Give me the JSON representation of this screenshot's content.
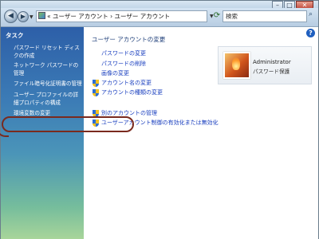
{
  "window": {
    "caption_buttons": {
      "minimize": "–",
      "maximize": "□",
      "close": "✕"
    }
  },
  "address": {
    "path": "« ユーザー アカウント › ユーザー アカウント",
    "search_placeholder": "検索"
  },
  "sidebar": {
    "heading": "タスク",
    "items": [
      {
        "label": "パスワード リセット ディスクの作成"
      },
      {
        "label": "ネットワーク パスワードの管理"
      },
      {
        "label": "ファイル暗号化証明書の管理"
      },
      {
        "label": "ユーザー プロファイルの詳細プロパティの構成"
      },
      {
        "label": "環境変数の変更"
      }
    ]
  },
  "main": {
    "title": "ユーザー アカウントの変更",
    "links": [
      {
        "label": "パスワードの変更"
      },
      {
        "label": "パスワードの削除"
      },
      {
        "label": "画像の変更"
      },
      {
        "label": "アカウント名の変更"
      },
      {
        "label": "アカウントの種類の変更"
      }
    ],
    "other_links": [
      {
        "label": "別のアカウントの管理"
      },
      {
        "label": "ユーザーアカウント制御の有効化または無効化"
      }
    ],
    "user": {
      "name": "Administrator",
      "status": "パスワード保護"
    }
  },
  "colors": {
    "link": "#1a3fbf",
    "heading": "#1f3f7a",
    "sidebar_top": "#2d5fa8",
    "sidebar_bottom": "#a8d59a",
    "highlight_ring": "#7a2a1e"
  },
  "icons": {
    "back": "back-arrow-icon",
    "forward": "forward-arrow-icon",
    "refresh": "refresh-icon",
    "search": "search-icon",
    "help": "help-icon",
    "shield": "uac-shield-icon"
  }
}
